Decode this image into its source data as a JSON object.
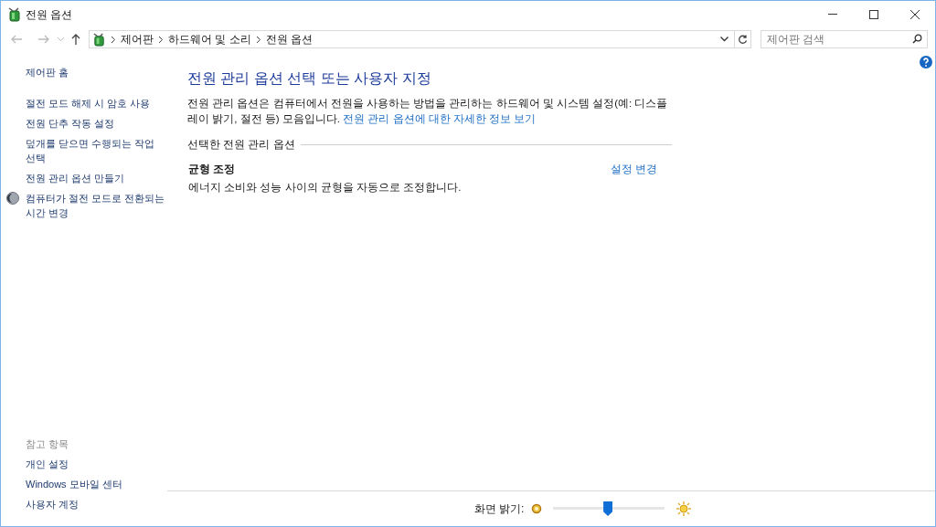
{
  "window": {
    "title": "전원 옵션"
  },
  "nav": {
    "breadcrumb": [
      "제어판",
      "하드웨어 및 소리",
      "전원 옵션"
    ],
    "search_placeholder": "제어판 검색"
  },
  "sidebar": {
    "home": "제어판 홈",
    "items": [
      {
        "kind": "plain",
        "label": "절전 모드 해제 시 암호 사용"
      },
      {
        "kind": "plain",
        "label": "전원 단추 작동 설정"
      },
      {
        "kind": "plain",
        "label": "덮개를 닫으면 수행되는 작업 선택"
      },
      {
        "kind": "plain",
        "label": "전원 관리 옵션 만들기"
      },
      {
        "kind": "icon",
        "label": "컴퓨터가 절전 모드로 전환되는 시간 변경"
      }
    ],
    "see_also_title": "참고 항목",
    "see_also": [
      "개인 설정",
      "Windows 모바일 센터",
      "사용자 계정"
    ]
  },
  "main": {
    "title": "전원 관리 옵션 선택 또는 사용자 지정",
    "description": "전원 관리 옵션은 컴퓨터에서 전원을 사용하는 방법을 관리하는 하드웨어 및 시스템 설정(예: 디스플레이 밝기, 절전 등) 모음입니다.",
    "description_link": "전원 관리 옵션에 대한 자세한 정보 보기",
    "section": "선택한 전원 관리 옵션",
    "plans": [
      {
        "name": "균형 조정",
        "description": "에너지 소비와 성능 사이의 균형을 자동으로 조정합니다.",
        "link": "설정 변경"
      }
    ]
  },
  "brightness": {
    "label": "화면 밝기:",
    "level": 0.49
  }
}
